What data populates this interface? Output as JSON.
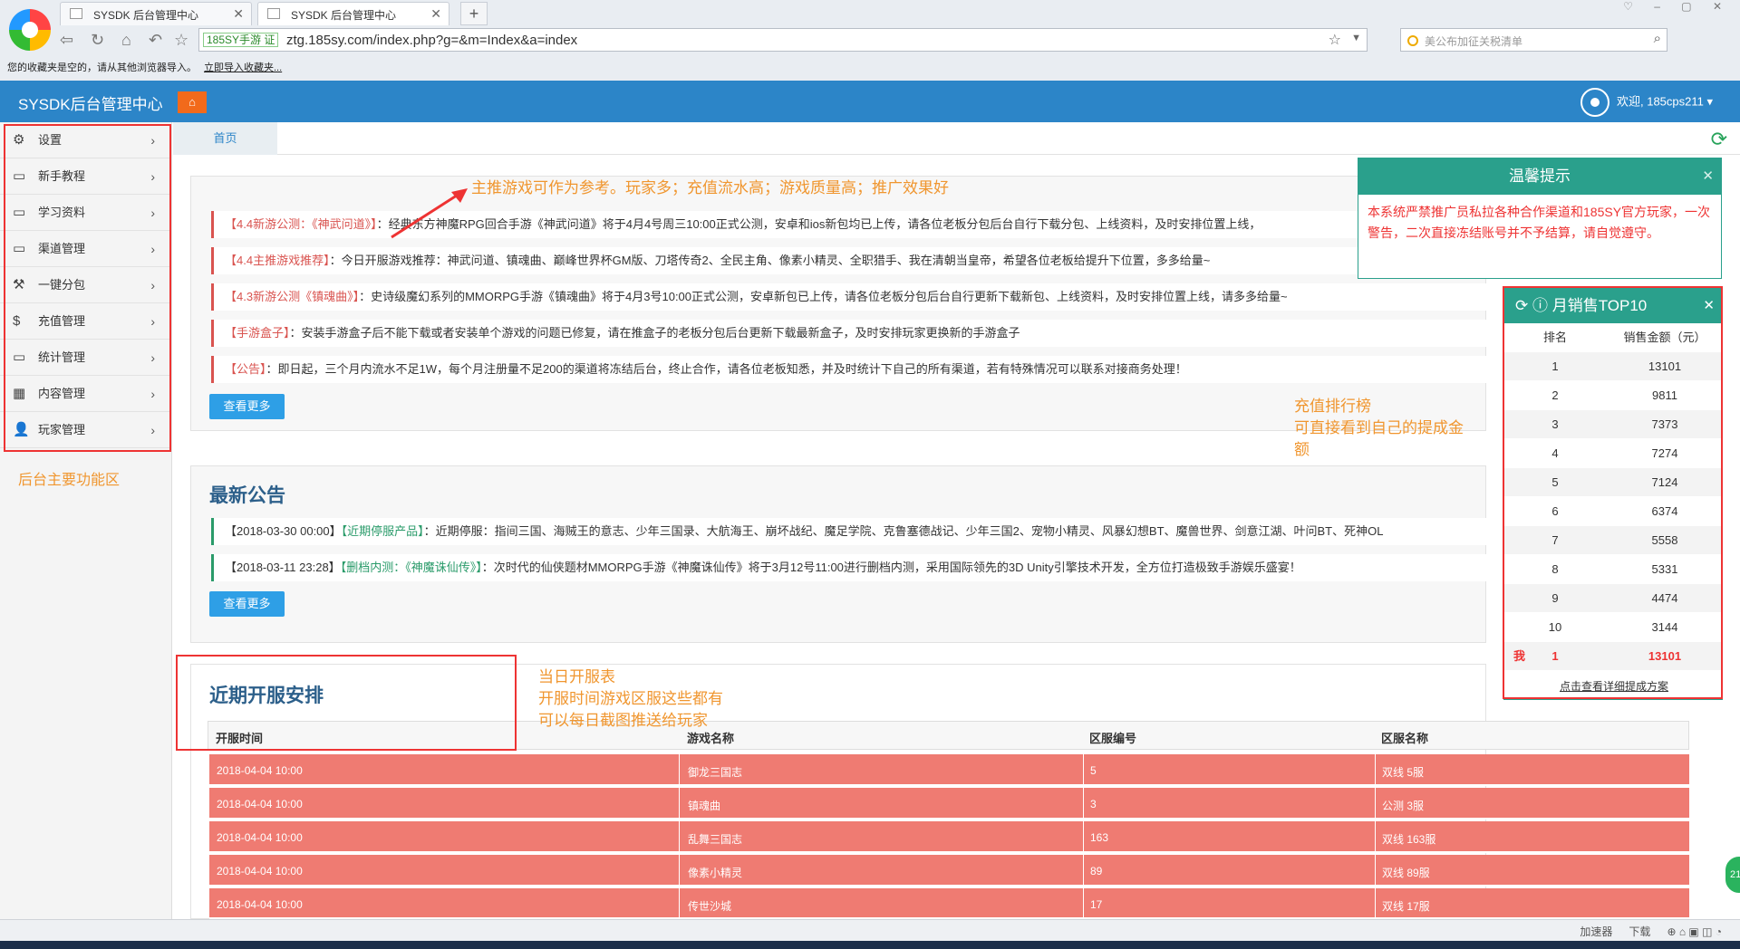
{
  "browser": {
    "tabs": [
      {
        "label": "SYSDK 后台管理中心"
      },
      {
        "label": "SYSDK 后台管理中心"
      }
    ],
    "new_tab": "+",
    "site_tag": "185SY手游 证",
    "url": "ztg.185sy.com/index.php?g=&m=Index&a=index",
    "search_placeholder": "美公布加征关税清单",
    "bookmark_text": "您的收藏夹是空的，请从其他浏览器导入。",
    "bookmark_link": "立即导入收藏夹..."
  },
  "header": {
    "brand": "SYSDK后台管理中心",
    "welcome": "欢迎, 185cps211 ▾"
  },
  "sidebar": {
    "items": [
      {
        "label": "设置",
        "icon": "gear-icon"
      },
      {
        "label": "新手教程",
        "icon": "monitor-icon"
      },
      {
        "label": "学习资料",
        "icon": "monitor-icon"
      },
      {
        "label": "渠道管理",
        "icon": "monitor-icon"
      },
      {
        "label": "一键分包",
        "icon": "wrench-icon"
      },
      {
        "label": "充值管理",
        "icon": "dollar-icon"
      },
      {
        "label": "统计管理",
        "icon": "monitor-icon"
      },
      {
        "label": "内容管理",
        "icon": "grid-icon"
      },
      {
        "label": "玩家管理",
        "icon": "user-icon"
      }
    ],
    "note": "后台主要功能区"
  },
  "tabstrip": {
    "home_tab": "首页"
  },
  "annotations": {
    "push_games": "主推游戏可作为参考。玩家多；充值流水高；游戏质量高；推广效果好",
    "ranking": [
      "充值排行榜",
      "可直接看到自己的提成金",
      "额"
    ],
    "schedule": [
      "当日开服表",
      "开服时间游戏区服这些都有",
      "可以每日截图推送给玩家"
    ]
  },
  "notices": [
    {
      "tag": "【4.4新游公测：《神武问道》】",
      "text": "：经典东方神魔RPG回合手游《神武问道》将于4月4号周三10:00正式公测，安卓和ios新包均已上传，请各位老板分包后台自行下载分包、上线资料，及时安排位置上线，"
    },
    {
      "tag": "【4.4主推游戏推荐】",
      "text": "：今日开服游戏推荐：神武问道、镇魂曲、巅峰世界杯GM版、刀塔传奇2、全民主角、像素小精灵、全职猎手、我在清朝当皇帝，希望各位老板给提升下位置，多多给量~"
    },
    {
      "tag": "【4.3新游公测《镇魂曲》】",
      "text": "：史诗级魔幻系列的MMORPG手游《镇魂曲》将于4月3号10:00正式公测，安卓新包已上传，请各位老板分包后台自行更新下载新包、上线资料，及时安排位置上线，请多多给量~"
    },
    {
      "tag": "【手游盒子】",
      "text": "：安装手游盒子后不能下载或者安装单个游戏的问题已修复，请在推盒子的老板分包后台更新下载最新盒子，及时安排玩家更换新的手游盒子"
    },
    {
      "tag": "【公告】",
      "text": "：即日起，三个月内流水不足1W，每个月注册量不足200的渠道将冻结后台，终止合作，请各位老板知悉，并及时统计下自己的所有渠道，若有特殊情况可以联系对接商务处理！"
    }
  ],
  "more_label": "查看更多",
  "latest": {
    "title": "最新公告",
    "items": [
      {
        "date": "【2018-03-30 00:00】",
        "tag": "【近期停服产品】",
        "text": "：近期停服：指间三国、海贼王的意志、少年三国录、大航海王、崩坏战纪、魔足学院、克鲁塞德战记、少年三国2、宠物小精灵、风暴幻想BT、魔兽世界、剑意江湖、叶问BT、死神OL"
      },
      {
        "date": "【2018-03-11 23:28】",
        "tag": "【删档内测：《神魔诛仙传》】",
        "text": "：次时代的仙侠题材MMORPG手游《神魔诛仙传》将于3月12号11:00进行删档内测，采用国际领先的3D Unity引擎技术开发，全方位打造极致手游娱乐盛宴！"
      }
    ]
  },
  "schedule": {
    "title": "近期开服安排",
    "columns": [
      "开服时间",
      "游戏名称",
      "区服编号",
      "区服名称"
    ],
    "rows": [
      [
        "2018-04-04 10:00",
        "御龙三国志",
        "5",
        "双线 5服"
      ],
      [
        "2018-04-04 10:00",
        "镇魂曲",
        "3",
        "公测 3服"
      ],
      [
        "2018-04-04 10:00",
        "乱舞三国志",
        "163",
        "双线 163服"
      ],
      [
        "2018-04-04 10:00",
        "像素小精灵",
        "89",
        "双线 89服"
      ],
      [
        "2018-04-04 10:00",
        "传世沙城",
        "17",
        "双线 17服"
      ]
    ]
  },
  "warning": {
    "title": "温馨提示",
    "body": "本系统严禁推广员私拉各种合作渠道和185SY官方玩家，一次警告，二次直接冻结账号并不予结算，请自觉遵守。"
  },
  "top10": {
    "title": "月销售TOP10",
    "col_rank": "排名",
    "col_amount": "销售金额（元）",
    "rows": [
      {
        "rank": "1",
        "amount": "13101"
      },
      {
        "rank": "2",
        "amount": "9811"
      },
      {
        "rank": "3",
        "amount": "7373"
      },
      {
        "rank": "4",
        "amount": "7274"
      },
      {
        "rank": "5",
        "amount": "7124"
      },
      {
        "rank": "6",
        "amount": "6374"
      },
      {
        "rank": "7",
        "amount": "5558"
      },
      {
        "rank": "8",
        "amount": "5331"
      },
      {
        "rank": "9",
        "amount": "4474"
      },
      {
        "rank": "10",
        "amount": "3144"
      }
    ],
    "me_label": "我",
    "me_rank": "1",
    "me_amount": "13101",
    "link": "点击查看详细提成方案"
  },
  "statusbar": {
    "accelerator": "加速器",
    "download": "下载"
  },
  "float_badge": "21"
}
